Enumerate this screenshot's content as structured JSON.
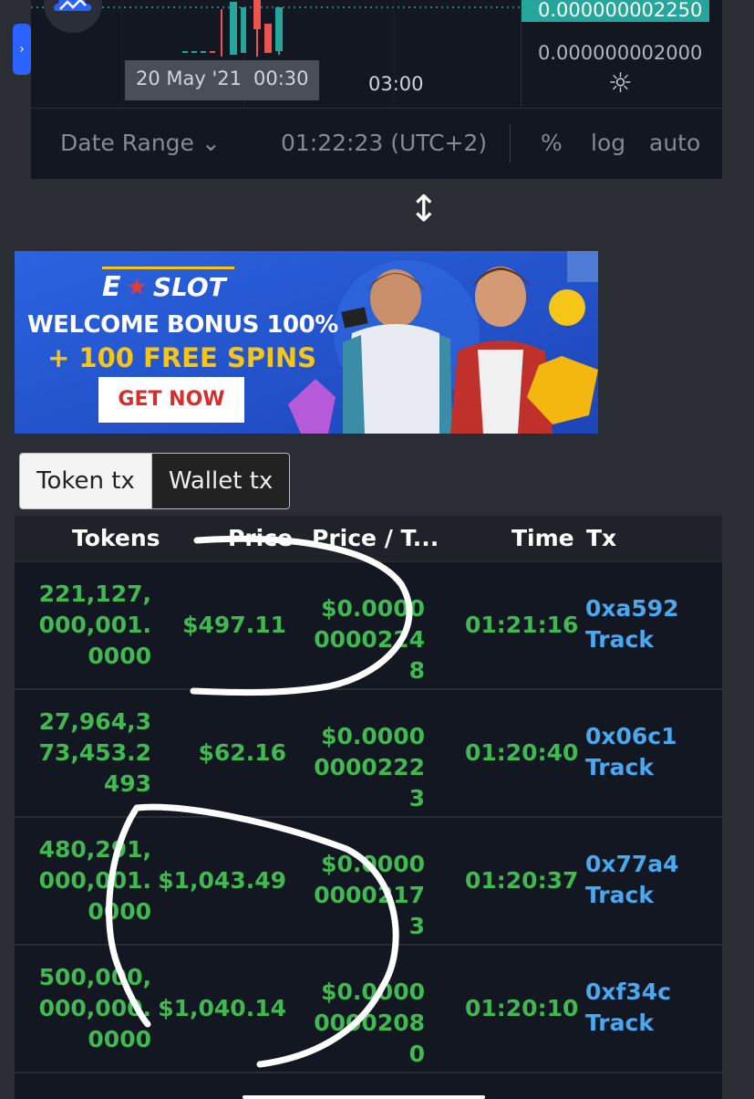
{
  "chart": {
    "price_badge": "0.000000002250",
    "price_axis_label": "0.000000002000",
    "time_date": "20 May '21",
    "time_clock": "00:30",
    "time_tick": "03:00",
    "range_label": "Date Range",
    "clock": "01:22:23 (UTC+2)",
    "percent_label": "%",
    "log_label": "log",
    "auto_label": "auto"
  },
  "ad": {
    "brand": "SLOT",
    "line1": "WELCOME BONUS 100%",
    "line2": "+ 100 FREE SPINS",
    "cta": "GET NOW"
  },
  "tabs": {
    "token_tx": "Token tx",
    "wallet_tx": "Wallet tx"
  },
  "table": {
    "headers": {
      "tokens": "Tokens",
      "price": "Price",
      "price_per_token": "Price / T...",
      "time": "Time",
      "tx": "Tx"
    },
    "rows": [
      {
        "tokens": "221,127,000,001.0000",
        "price": "$497.11",
        "ppt": "$0.000000002248",
        "time": "01:21:16",
        "hash": "0xa592",
        "track": "Track"
      },
      {
        "tokens": "27,964,373,453.2493",
        "price": "$62.16",
        "ppt": "$0.000000002223",
        "time": "01:20:40",
        "hash": "0x06c1",
        "track": "Track"
      },
      {
        "tokens": "480,291,000,001.0000",
        "price": "$1,043.49",
        "ppt": "$0.000000002173",
        "time": "01:20:37",
        "hash": "0x77a4",
        "track": "Track"
      },
      {
        "tokens": "500,000,000,000.0000",
        "price": "$1,040.14",
        "ppt": "$0.000000002080",
        "time": "01:20:10",
        "hash": "0xf34c",
        "track": "Track"
      }
    ]
  }
}
